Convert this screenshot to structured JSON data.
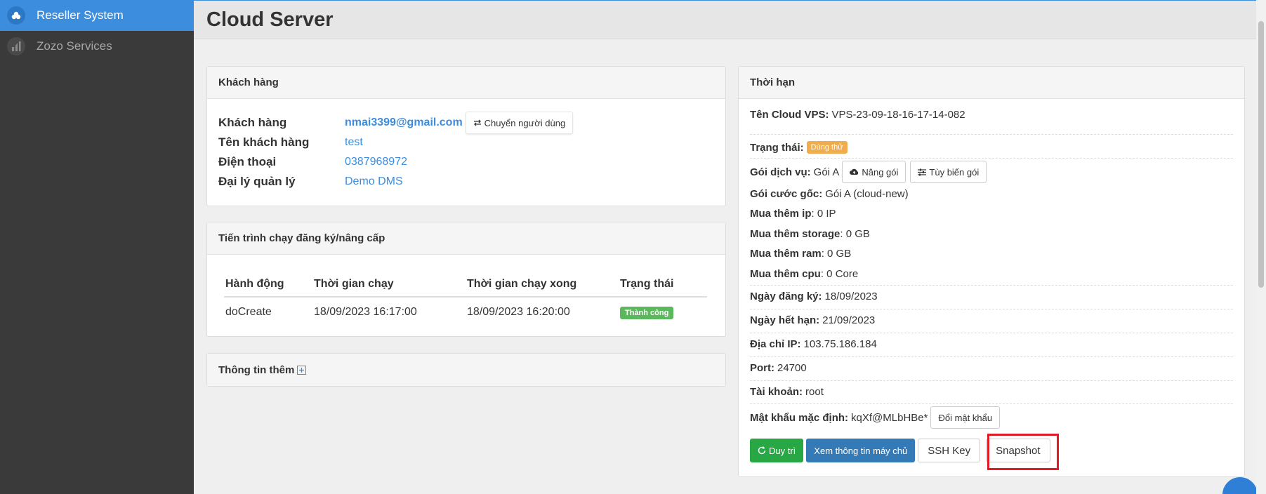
{
  "sidebar": {
    "items": [
      {
        "label": "Reseller System",
        "icon": "cloud-icon",
        "active": true
      },
      {
        "label": "Zozo Services",
        "icon": "chart-icon",
        "active": false
      }
    ]
  },
  "page": {
    "title": "Cloud Server"
  },
  "customer": {
    "heading": "Khách hàng",
    "rows": [
      {
        "label": "Khách hàng",
        "value": "nmai3399@gmail.com"
      },
      {
        "label": "Tên khách hàng",
        "value": "test"
      },
      {
        "label": "Điện thoại",
        "value": "0387968972"
      },
      {
        "label": "Đại lý quản lý",
        "value": "Demo DMS"
      }
    ],
    "switch_user_button": "Chuyển người dùng"
  },
  "process": {
    "heading": "Tiến trình chạy đăng ký/nâng cấp",
    "columns": [
      "Hành động",
      "Thời gian chạy",
      "Thời gian chạy xong",
      "Trạng thái"
    ],
    "rows": [
      {
        "action": "doCreate",
        "start": "18/09/2023 16:17:00",
        "end": "18/09/2023 16:20:00",
        "status": "Thành công"
      }
    ]
  },
  "more_info": {
    "heading": "Thông tin thêm"
  },
  "term": {
    "heading": "Thời hạn",
    "vps_name_label": "Tên Cloud VPS:",
    "vps_name": "VPS-23-09-18-16-17-14-082",
    "status_label": "Trạng thái:",
    "status": "Dùng thử",
    "package_label": "Gói dịch vụ:",
    "package": "Gói A",
    "upgrade_button": "Nâng gói",
    "customize_button": "Tùy biến gói",
    "base_plan_label": "Gói cước gốc:",
    "base_plan": "Gói A (cloud-new)",
    "extra_ip_label": "Mua thêm ip",
    "extra_ip": ": 0 IP",
    "extra_storage_label": "Mua thêm storage",
    "extra_storage": ": 0 GB",
    "extra_ram_label": "Mua thêm ram",
    "extra_ram": ": 0 GB",
    "extra_cpu_label": "Mua thêm cpu",
    "extra_cpu": ": 0 Core",
    "reg_date_label": "Ngày đăng ký:",
    "reg_date": "18/09/2023",
    "exp_date_label": "Ngày hết hạn:",
    "exp_date": "21/09/2023",
    "ip_label": "Địa chỉ IP:",
    "ip": "103.75.186.184",
    "port_label": "Port:",
    "port": "24700",
    "account_label": "Tài khoản:",
    "account": "root",
    "password_label": "Mật khẩu mặc định:",
    "password": "kqXf@MLbHBe*",
    "change_password_button": "Đổi mật khẩu",
    "actions": {
      "maintain": "Duy trì",
      "view_info": "Xem thông tin máy chủ",
      "ssh_key": "SSH Key",
      "snapshot": "Snapshot"
    }
  },
  "colors": {
    "accent": "#3c8dde",
    "success": "#28a745",
    "primary": "#337ab7",
    "warning": "#f0ad4e",
    "highlight": "#e01b24"
  }
}
